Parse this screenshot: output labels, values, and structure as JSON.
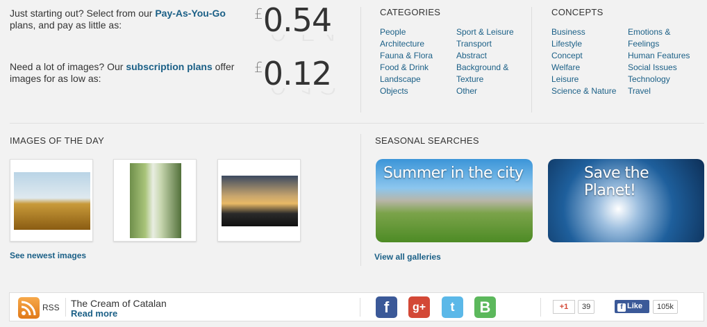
{
  "payg": {
    "pre": "Just starting out? Select from our ",
    "link": "Pay-As-You-Go",
    "post": " plans, and pay as little as:",
    "currency": "£",
    "price": "0.54"
  },
  "subs": {
    "pre": "Need a lot of images? Our ",
    "link": "subscription plans",
    "post": " offer images for as low as:",
    "currency": "£",
    "price": "0.12"
  },
  "categories": {
    "heading": "CATEGORIES",
    "col1": [
      "People",
      "Architecture",
      "Fauna & Flora",
      "Food & Drink",
      "Landscape",
      "Objects"
    ],
    "col2": [
      "Sport & Leisure",
      "Transport",
      "Abstract",
      "Background & Texture",
      "Other"
    ]
  },
  "concepts": {
    "heading": "CONCEPTS",
    "col1": [
      "Business",
      "Lifestyle",
      "Concept",
      "Welfare",
      "Leisure",
      "Science & Nature"
    ],
    "col2": [
      "Emotions & Feelings",
      "Human Features",
      "Social Issues",
      "Technology",
      "Travel"
    ]
  },
  "images_of_day": {
    "heading": "IMAGES OF THE DAY",
    "more": "See newest images"
  },
  "seasonal": {
    "heading": "SEASONAL SEARCHES",
    "gallery1": "Summer in the city",
    "gallery2": "Save the Planet!",
    "more": "View all galleries"
  },
  "footer": {
    "rss": "RSS",
    "blog_title": "The Cream of Catalan",
    "read_more": "Read more",
    "gplus_label": "+1",
    "gplus_count": "39",
    "fb_label": "Like",
    "fb_count": "105k"
  },
  "colors": {
    "link": "#1a5f86",
    "facebook": "#3b5998",
    "googleplus": "#d34836",
    "twitter": "#5bb8e8",
    "blogger_b": "#5cb85c"
  }
}
